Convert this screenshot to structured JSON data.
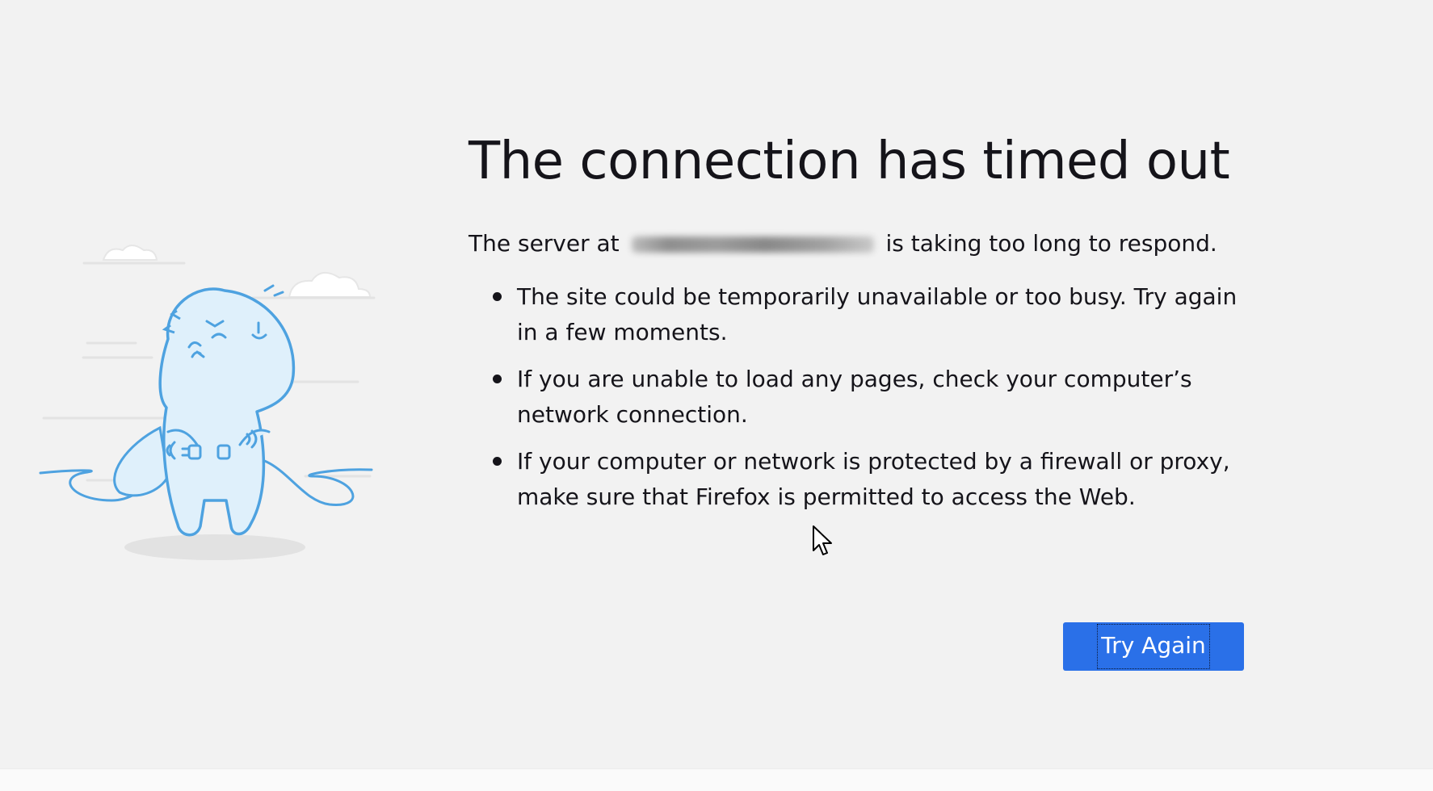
{
  "error_page": {
    "title": "The connection has timed out",
    "intro_before": "The server at",
    "intro_after": "is taking too long to respond.",
    "tips": [
      "The site could be temporarily unavailable or too busy. Try again in a few moments.",
      "If you are unable to load any pages, check your computer’s network connection.",
      "If your computer or network is protected by a firewall or proxy, make sure that Firefox is permitted to access the Web."
    ],
    "try_again_label": "Try Again"
  },
  "colors": {
    "background": "#f2f2f2",
    "text": "#15141a",
    "button": "#2a70e8",
    "illustration_stroke": "#4ea2e0",
    "illustration_fill": "#dff0fb"
  },
  "icons": {
    "illustration": "unplugged-dinosaur-illustration",
    "cursor": "mouse-pointer-icon"
  }
}
